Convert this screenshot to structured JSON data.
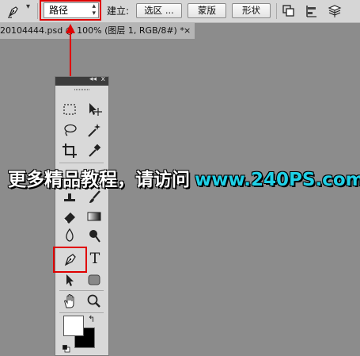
{
  "options_bar": {
    "tool_icon": "pen-icon",
    "mode_value": "路径",
    "make_label": "建立:",
    "selection_button": "选区 ...",
    "mask_button": "蒙版",
    "shape_button": "形状",
    "icons": [
      "path-operations-icon",
      "path-alignment-icon",
      "path-arrangement-icon"
    ]
  },
  "document_tab": {
    "title": "20104444.psd @ 100% (图层 1, RGB/8#) *",
    "close": "×"
  },
  "tools_panel": {
    "collapse_glyph": "◂◂",
    "close_glyph": "x",
    "tools": [
      "marquee-icon",
      "move-icon",
      "lasso-icon",
      "magic-wand-icon",
      "crop-icon",
      "eyedropper-icon",
      "spot-healing-icon",
      "brush-icon",
      "stamp-icon",
      "history-brush-icon",
      "eraser-icon",
      "gradient-icon",
      "blur-icon",
      "dodge-icon",
      "pen-icon",
      "type-icon",
      "path-selection-icon",
      "shape-icon",
      "hand-icon",
      "zoom-icon"
    ],
    "type_glyph": "T",
    "swap_glyph": "↰"
  },
  "colors": {
    "highlight": "#e00000",
    "foreground": "#ffffff",
    "background": "#000000",
    "watermark_cn": "#ffffff",
    "watermark_url": "#1fd0e6"
  },
  "watermark": {
    "cn": "更多精品教程，请访问",
    "url": "www.240PS.com"
  }
}
